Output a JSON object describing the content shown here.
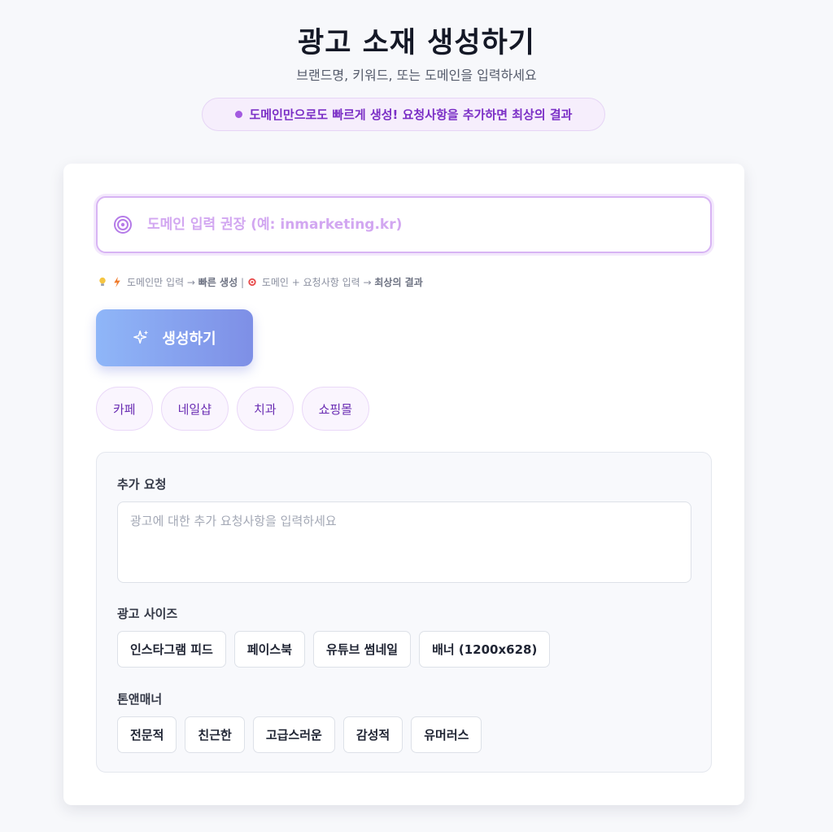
{
  "header": {
    "title": "광고 소재 생성하기",
    "subtitle": "브랜드명, 키워드, 또는 도메인을 입력하세요",
    "notice": "도메인만으로도 빠르게 생성! 요청사항을 추가하면 최상의 결과"
  },
  "domain_input": {
    "placeholder": "도메인 입력 권장 (예: inmarketing.kr)",
    "value": "",
    "icon": "target-icon"
  },
  "hint": {
    "part1": "도메인만 입력 →",
    "part1_bold": "빠른 생성",
    "separator": "|",
    "part2": "도메인 + 요청사항 입력 →",
    "part2_bold": "최상의 결과",
    "icons": [
      "lightbulb-icon",
      "lightning-icon",
      "target-icon"
    ]
  },
  "generate_button": {
    "label": "생성하기",
    "icon": "sparkle-icon"
  },
  "quick_chips": [
    "카페",
    "네일샵",
    "치과",
    "쇼핑몰"
  ],
  "extra": {
    "request_label": "추가 요청",
    "request_placeholder": "광고에 대한 추가 요청사항을 입력하세요",
    "size_label": "광고 사이즈",
    "sizes": [
      "인스타그램 피드",
      "페이스북",
      "유튜브 썸네일",
      "배너 (1200x628)"
    ],
    "tone_label": "톤앤매너",
    "tones": [
      "전문적",
      "친근한",
      "고급스러운",
      "감성적",
      "유머러스"
    ]
  },
  "colors": {
    "accent_purple": "#7b2fc6",
    "button_gradient_start": "#8fb6f8",
    "button_gradient_end": "#7e8fe6",
    "background": "#f7f8fb"
  }
}
